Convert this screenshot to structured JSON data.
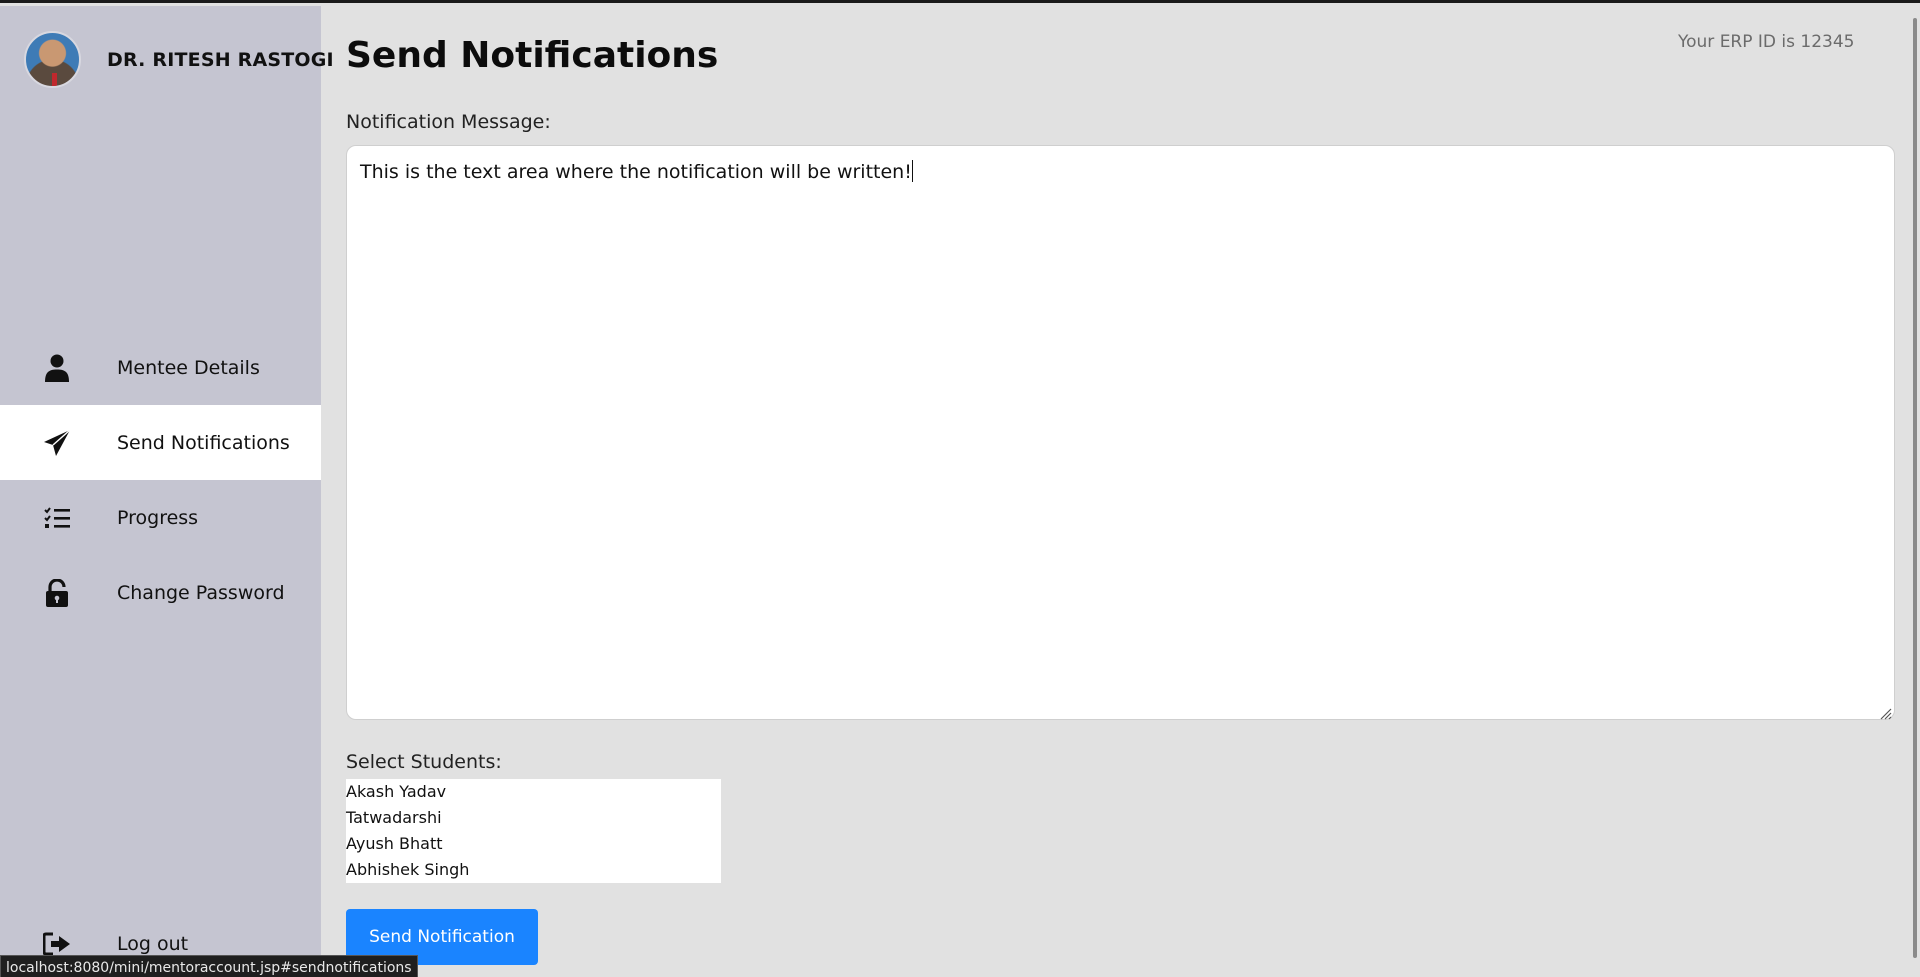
{
  "sidebar": {
    "profile_name": "DR. RITESH RASTOGI",
    "items": [
      {
        "label": "Mentee Details",
        "icon": "user-icon",
        "active": false
      },
      {
        "label": "Send Notifications",
        "icon": "paper-plane-icon",
        "active": true
      },
      {
        "label": "Progress",
        "icon": "checklist-icon",
        "active": false
      },
      {
        "label": "Change Password",
        "icon": "unlock-icon",
        "active": false
      }
    ],
    "logout_label": "Log out"
  },
  "header": {
    "erp_text": "Your ERP ID is 12345",
    "title": "Send Notifications"
  },
  "form": {
    "message_label": "Notification Message:",
    "message_value": "This is the text area where the notification will be written!",
    "students_label": "Select Students:",
    "students": [
      "Akash Yadav",
      "Tatwadarshi",
      "Ayush Bhatt",
      "Abhishek Singh"
    ],
    "submit_label": "Send Notification"
  },
  "status_bar": {
    "url": "localhost:8080/mini/mentoraccount.jsp#sendnotifications"
  },
  "colors": {
    "sidebar_bg": "#c5c5d1",
    "main_bg": "#e1e1e1",
    "button_bg": "#1a84ff",
    "active_item_bg": "#ffffff"
  }
}
